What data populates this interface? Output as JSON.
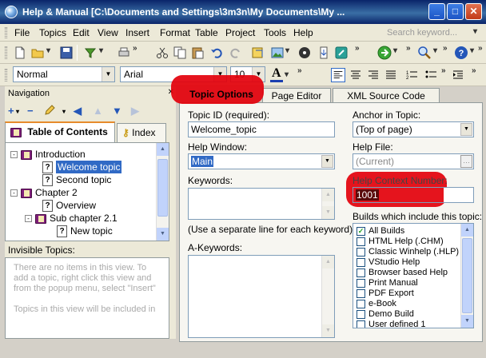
{
  "window": {
    "title": "Help & Manual [C:\\Documents and Settings\\3m3n\\My Documents\\My ...",
    "minimize": "_",
    "maximize": "□",
    "close": "✕"
  },
  "menu": {
    "items": [
      "File",
      "Topics",
      "Edit",
      "View",
      "Insert",
      "Format",
      "Table",
      "Project",
      "Tools",
      "Help"
    ],
    "search_placeholder": "Search keyword..."
  },
  "format_bar": {
    "style": "Normal",
    "font": "Arial",
    "size": "10",
    "font_color_label": "A"
  },
  "navigation": {
    "title": "Navigation",
    "tabs": [
      "Table of Contents",
      "Index"
    ],
    "tree": [
      {
        "label": "Introduction",
        "type": "book",
        "level": 0,
        "expander": "-"
      },
      {
        "label": "Welcome topic",
        "type": "topic",
        "level": 1,
        "selected": true
      },
      {
        "label": "Second topic",
        "type": "topic",
        "level": 1
      },
      {
        "label": "Chapter 2",
        "type": "book",
        "level": 0,
        "expander": "-"
      },
      {
        "label": "Overview",
        "type": "topic",
        "level": 1
      },
      {
        "label": "Sub chapter 2.1",
        "type": "book",
        "level": 1,
        "expander": "-"
      },
      {
        "label": "New topic",
        "type": "topic",
        "level": 2
      }
    ],
    "invisible_label": "Invisible Topics:",
    "invisible_text": "There are no items in this view. To add a topic, right click this view and from the popup menu, select \"Insert\"\n\nTopics in this view will be included in"
  },
  "tabs": [
    "Topic Options",
    "Page Editor",
    "XML Source Code"
  ],
  "topic_options": {
    "topic_id_label": "Topic ID (required):",
    "topic_id_value": "Welcome_topic",
    "help_window_label": "Help Window:",
    "help_window_value": "Main",
    "keywords_label": "Keywords:",
    "keywords_hint": "(Use a separate line for each keyword)",
    "akeywords_label": "A-Keywords:",
    "anchor_label": "Anchor in Topic:",
    "anchor_value": "(Top of page)",
    "help_file_label": "Help File:",
    "help_file_value": "(Current)",
    "context_number_label": "Help Context Number:",
    "context_number_value": "1001",
    "builds_label": "Builds which include this topic:",
    "builds": [
      {
        "label": "All Builds",
        "checked": true
      },
      {
        "label": "HTML Help (.CHM)",
        "checked": false
      },
      {
        "label": "Classic Winhelp (.HLP)",
        "checked": false
      },
      {
        "label": "VStudio Help",
        "checked": false
      },
      {
        "label": "Browser based Help",
        "checked": false
      },
      {
        "label": "Print Manual",
        "checked": false
      },
      {
        "label": "PDF Export",
        "checked": false
      },
      {
        "label": "e-Book",
        "checked": false
      },
      {
        "label": "Demo Build",
        "checked": false
      },
      {
        "label": "User defined 1",
        "checked": false
      }
    ]
  },
  "colors": {
    "highlight": "#e3000b",
    "selection": "#316ac5",
    "titlebar": "#0a246a"
  }
}
